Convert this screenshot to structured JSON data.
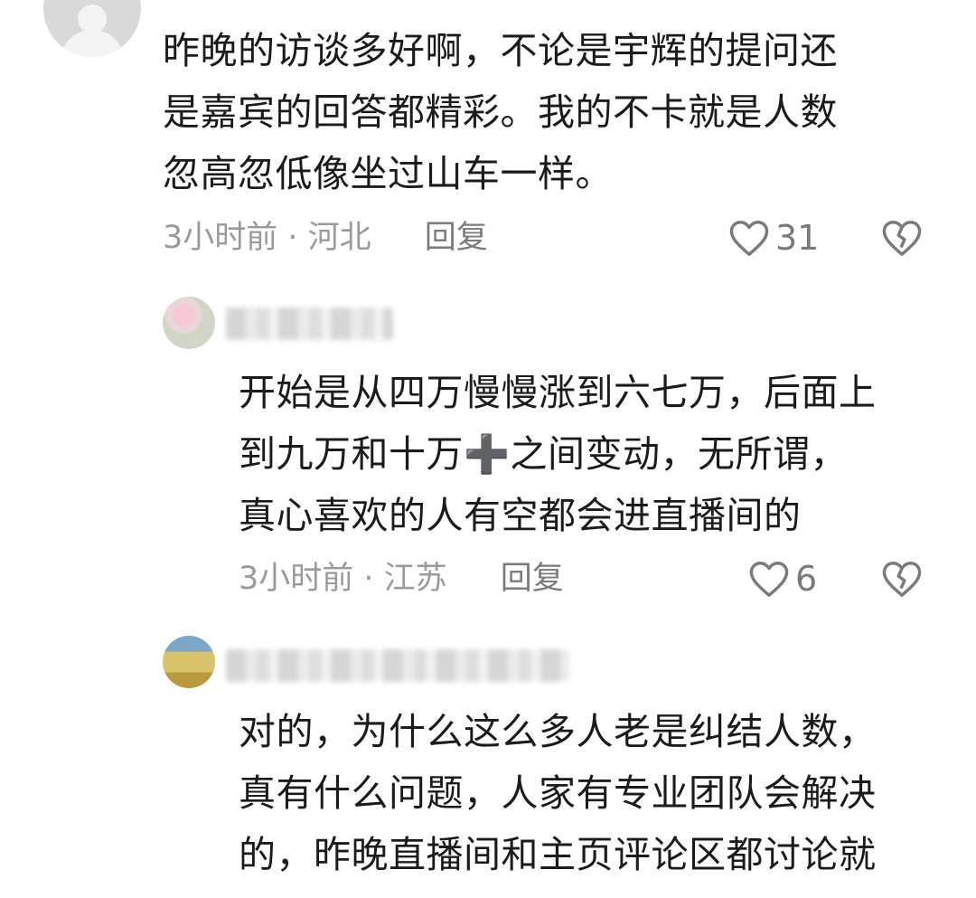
{
  "comments": [
    {
      "text_lines": [
        "昨晚的访谈多好啊，不论是宇辉的提问还",
        "是嘉宾的回答都精彩。我的不卡就是人数",
        "忽高忽低像坐过山车一样。"
      ],
      "time": "3小时前 · 河北",
      "reply": "回复",
      "likes": "31"
    },
    {
      "text_lines": [
        "开始是从四万慢慢涨到六七万，后面上",
        "到九万和十万➕之间变动，无所谓，",
        "真心喜欢的人有空都会进直播间的"
      ],
      "time": "3小时前 · 江苏",
      "reply": "回复",
      "likes": "6"
    },
    {
      "text_lines": [
        "对的，为什么这么多人老是纠结人数，",
        "真有什么问题，人家有专业团队会解决",
        "的，昨晚直播间和主页评论区都讨论就"
      ],
      "time": "",
      "reply": "",
      "likes": ""
    }
  ],
  "icons": {
    "like": "heart-outline-icon",
    "dislike": "broken-heart-icon"
  },
  "colors": {
    "text": "#1b1b1b",
    "meta": "#9a9a9a",
    "icon": "#7a7a7a"
  }
}
